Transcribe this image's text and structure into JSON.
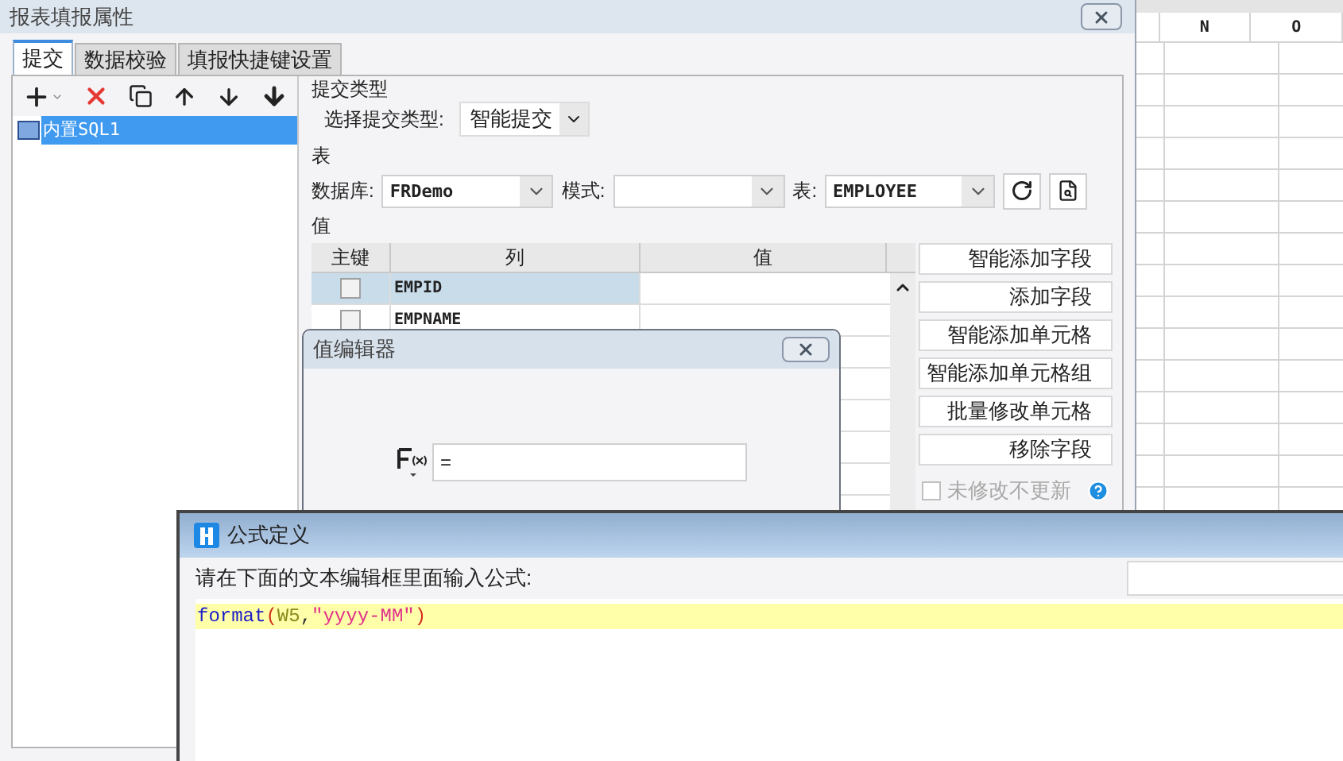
{
  "main_window": {
    "title": "报表填报属性"
  },
  "tabs": [
    {
      "label": "提交",
      "selected": true
    },
    {
      "label": "数据校验",
      "selected": false
    },
    {
      "label": "填报快捷键设置",
      "selected": false
    }
  ],
  "tree": {
    "items": [
      {
        "label": "内置SQL1",
        "selected": true
      }
    ]
  },
  "submit_type": {
    "legend": "提交类型",
    "label": "选择提交类型:",
    "value": "智能提交"
  },
  "table_section": {
    "legend": "表",
    "database_label": "数据库:",
    "database_value": "FRDemo",
    "schema_label": "模式:",
    "table_label": "表:",
    "table_value": "EMPLOYEE"
  },
  "values_section": {
    "legend": "值",
    "columns": [
      "主键",
      "列",
      "值"
    ],
    "rows": [
      {
        "key_checked": false,
        "column": "EMPID",
        "selected": true
      },
      {
        "key_checked": false,
        "column": "EMPNAME",
        "selected": false
      }
    ],
    "buttons": [
      "智能添加字段",
      "添加字段",
      "智能添加单元格",
      "智能添加单元格组",
      "批量修改单元格",
      "移除字段"
    ],
    "unchanged_option": {
      "label": "未修改不更新",
      "checked": false,
      "disabled": true
    }
  },
  "spreadsheet": {
    "columns": [
      "N",
      "O"
    ]
  },
  "value_editor": {
    "title": "值编辑器",
    "value": "="
  },
  "formula_dialog": {
    "title": "公式定义",
    "prompt": "请在下面的文本编辑框里面输入公式:",
    "code": [
      {
        "text": "format",
        "kind": "function"
      },
      {
        "text": "(",
        "kind": "paren"
      },
      {
        "text": "W5",
        "kind": "ref"
      },
      {
        "text": ",",
        "kind": "punct"
      },
      {
        "text": "\"yyyy-MM\"",
        "kind": "string"
      },
      {
        "text": ")",
        "kind": "paren"
      }
    ]
  }
}
